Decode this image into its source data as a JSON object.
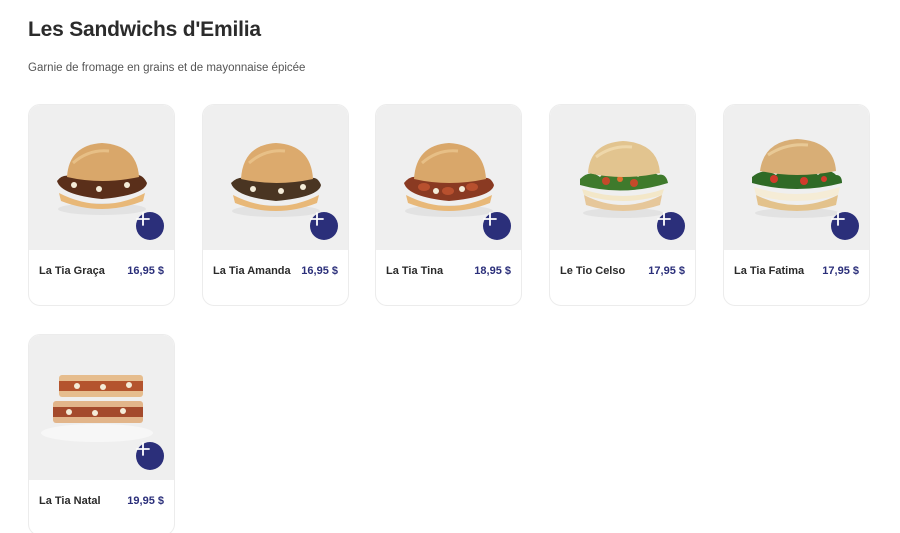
{
  "section": {
    "title": "Les Sandwichs d'Emilia",
    "subtitle": "Garnie de fromage en grains et de mayonnaise épicée"
  },
  "theme": {
    "accent": "#2b2f7a",
    "card_image_bg": "#efefef"
  },
  "items": [
    {
      "name": "La Tia Graça",
      "price": "16,95 $",
      "image": "sandwich-bun-meat-icon",
      "add_icon": "plus-icon"
    },
    {
      "name": "La Tia Amanda",
      "price": "16,95 $",
      "image": "sandwich-bun-beef-icon",
      "add_icon": "plus-icon"
    },
    {
      "name": "La Tia Tina",
      "price": "18,95 $",
      "image": "sandwich-bun-sausage-icon",
      "add_icon": "plus-icon"
    },
    {
      "name": "Le Tio Celso",
      "price": "17,95 $",
      "image": "sandwich-bun-greens-icon",
      "add_icon": "plus-icon"
    },
    {
      "name": "La Tia Fatima",
      "price": "17,95 $",
      "image": "sandwich-bun-salad-icon",
      "add_icon": "plus-icon"
    },
    {
      "name": "La Tia Natal",
      "price": "19,95 $",
      "image": "grilled-sandwich-icon",
      "add_icon": "plus-icon"
    }
  ]
}
